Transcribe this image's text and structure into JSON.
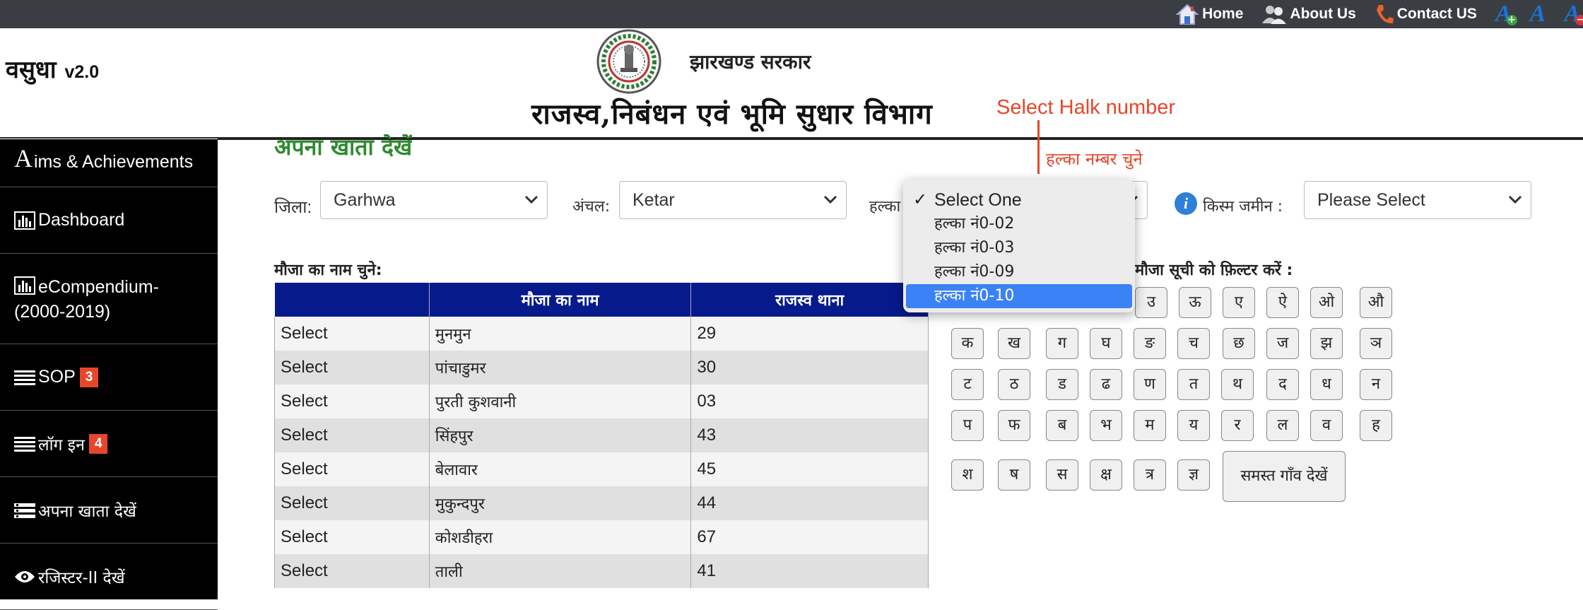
{
  "topnav": {
    "home": "Home",
    "about": "About Us",
    "contact": "Contact US",
    "font_increase": "A",
    "font_normal": "A",
    "font_decrease": "A"
  },
  "header": {
    "brand": "वसुधा",
    "version": "v2.0",
    "government": "झारखण्ड सरकार",
    "department": "राजस्व,निबंधन एवं भूमि सुधार  विभाग"
  },
  "annotation": {
    "english": "Select Halk number",
    "hindi": "हल्का नम्बर चुने"
  },
  "sidebar": {
    "items": [
      {
        "first_letter": "A",
        "label": "ims & Achievements",
        "icon": "letter-icon"
      },
      {
        "label": "Dashboard",
        "icon": "bar-chart-icon"
      },
      {
        "label": "eCompendium-(2000-2019)",
        "icon": "bar-chart-icon"
      },
      {
        "label": "SOP",
        "badge": "3",
        "icon": "list-icon"
      },
      {
        "label": "लॉग इन",
        "badge": "4",
        "icon": "list-icon"
      },
      {
        "label": "अपना खाता देखें",
        "icon": "list-check-icon"
      },
      {
        "label": "रजिस्टर-II देखें",
        "icon": "eye-icon"
      }
    ]
  },
  "main": {
    "heading": "अपना खाता देखें",
    "filters": {
      "district_label": "जिला:",
      "district_value": "Garhwa",
      "circle_label": "अंचल:",
      "circle_value": "Ketar",
      "halka_label": "हल्का",
      "land_type_label": "किस्म जमीन :",
      "land_type_value": "Please Select"
    },
    "halka_dropdown": {
      "options": [
        "Select One",
        "हल्का नं0-02",
        "हल्का नं0-03",
        "हल्का नं0-09",
        "हल्का नं0-10"
      ],
      "checked": "Select One",
      "highlighted": "हल्का नं0-10"
    },
    "mauza_section_label": "मौजा का नाम चुने:",
    "filter_section_label": "मौजा सूची को फ़िल्टर करें :",
    "table": {
      "headers": [
        "",
        "मौजा का नाम",
        "राजस्व थाना"
      ],
      "rows": [
        {
          "action": "Select",
          "name": "मुनमुन",
          "thana": "29"
        },
        {
          "action": "Select",
          "name": "पांचाडुमर",
          "thana": "30"
        },
        {
          "action": "Select",
          "name": "पुरती कुशवानी",
          "thana": "03"
        },
        {
          "action": "Select",
          "name": "सिंहपुर",
          "thana": "43"
        },
        {
          "action": "Select",
          "name": "बेलावार",
          "thana": "45"
        },
        {
          "action": "Select",
          "name": "मुकुन्दपुर",
          "thana": "44"
        },
        {
          "action": "Select",
          "name": "कोशडीहरा",
          "thana": "67"
        },
        {
          "action": "Select",
          "name": "ताली",
          "thana": "41"
        }
      ]
    },
    "letters": {
      "row1": [
        "उ",
        "ऊ",
        "ए",
        "ऐ",
        "ओ",
        "औ"
      ],
      "row2": [
        "क",
        "ख",
        "ग",
        "घ",
        "ङ",
        "च",
        "छ",
        "ज",
        "झ",
        "ञ"
      ],
      "row3": [
        "ट",
        "ठ",
        "ड",
        "ढ",
        "ण",
        "त",
        "थ",
        "द",
        "ध",
        "न"
      ],
      "row4": [
        "प",
        "फ",
        "ब",
        "भ",
        "म",
        "य",
        "र",
        "ल",
        "व",
        "ह"
      ],
      "row5": [
        "श",
        "ष",
        "स",
        "क्ष",
        "त्र",
        "ज्ञ"
      ]
    },
    "all_villages_button": "समस्त गाँव देखें"
  }
}
